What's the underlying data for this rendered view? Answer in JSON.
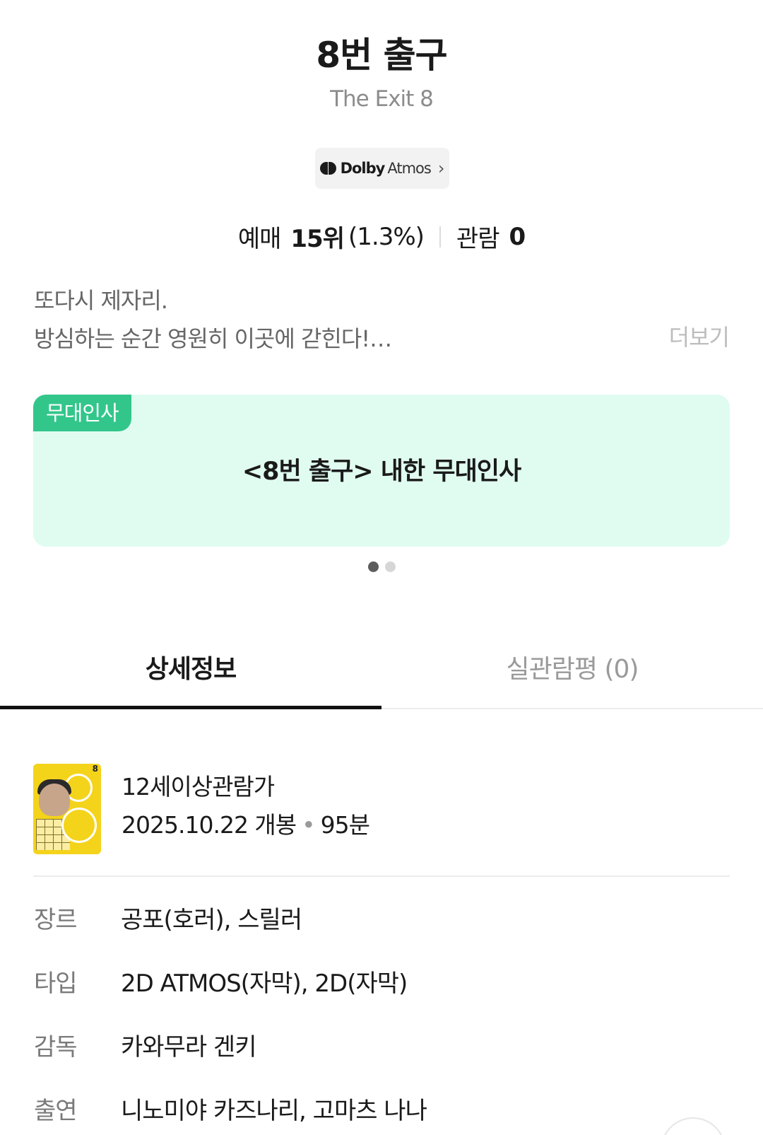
{
  "header": {
    "title": "8번 출구",
    "subtitle": "The Exit 8"
  },
  "badge": {
    "brand": "Dolby",
    "product": "Atmos",
    "icon": "chevron-right-icon"
  },
  "stats": {
    "reservation_label": "예매",
    "reservation_rank": "15위",
    "reservation_pct": "(1.3%)",
    "audience_label": "관람",
    "audience_value": "0"
  },
  "synopsis": {
    "line1": "또다시 제자리.",
    "line2": "방심하는 순간 영원히 이곳에 갇힌다!…",
    "more_label": "더보기"
  },
  "banner": {
    "tag": "무대인사",
    "title": "<8번 출구> 내한 무대인사",
    "bg_color": "#e0fcf1",
    "tag_color": "#33c68b"
  },
  "carousel": {
    "current": 1,
    "total": 2
  },
  "tabs": [
    {
      "label": "상세정보",
      "active": true
    },
    {
      "label": "실관람평 (0)",
      "active": false
    }
  ],
  "movie_info": {
    "rating": "12세이상관람가",
    "release_date": "2025.10.22 개봉",
    "bullet": "•",
    "runtime": "95분",
    "details": [
      {
        "key": "장르",
        "value": "공포(호러), 스릴러"
      },
      {
        "key": "타입",
        "value": "2D ATMOS(자막), 2D(자막)"
      },
      {
        "key": "감독",
        "value": "카와무라 겐키"
      },
      {
        "key": "출연",
        "value": "니노미야 카즈나리, 고마츠 나나"
      }
    ]
  }
}
